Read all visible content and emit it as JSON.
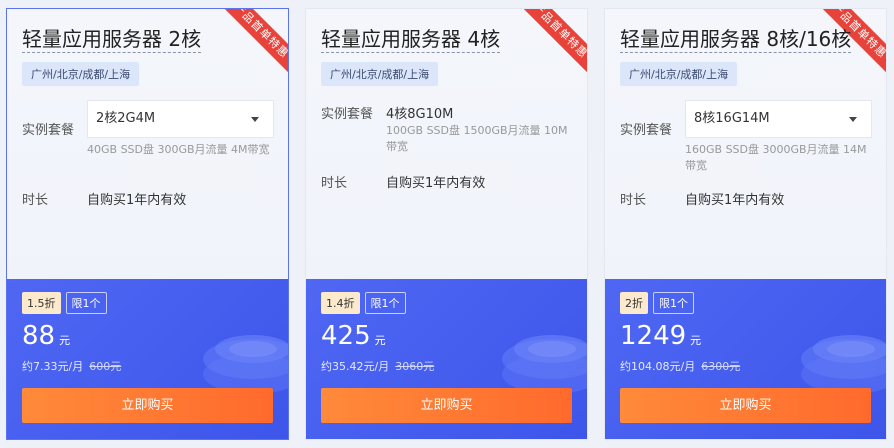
{
  "ribbon_text": "产品首单特惠",
  "cards": [
    {
      "title": "轻量应用服务器 2核",
      "region": "广州/北京/成都/上海",
      "spec_label": "实例套餐",
      "spec_value": "2核2G4M",
      "spec_desc": "40GB SSD盘 300GB月流量 4M带宽",
      "duration_label": "时长",
      "duration_value": "自购买1年内有效",
      "discount": "1.5折",
      "limit": "限1个",
      "price": "88",
      "price_unit": "元",
      "monthly": "约7.33元/月",
      "original": "600元",
      "buy_label": "立即购买"
    },
    {
      "title": "轻量应用服务器 4核",
      "region": "广州/北京/成都/上海",
      "spec_label": "实例套餐",
      "spec_value": "4核8G10M",
      "spec_desc": "100GB SSD盘 1500GB月流量 10M带宽",
      "duration_label": "时长",
      "duration_value": "自购买1年内有效",
      "discount": "1.4折",
      "limit": "限1个",
      "price": "425",
      "price_unit": "元",
      "monthly": "约35.42元/月",
      "original": "3060元",
      "buy_label": "立即购买"
    },
    {
      "title": "轻量应用服务器 8核/16核",
      "region": "广州/北京/成都/上海",
      "spec_label": "实例套餐",
      "spec_value": "8核16G14M",
      "spec_desc": "160GB SSD盘 3000GB月流量 14M带宽",
      "duration_label": "时长",
      "duration_value": "自购买1年内有效",
      "discount": "2折",
      "limit": "限1个",
      "price": "1249",
      "price_unit": "元",
      "monthly": "约104.08元/月",
      "original": "6300元",
      "buy_label": "立即购买"
    }
  ]
}
